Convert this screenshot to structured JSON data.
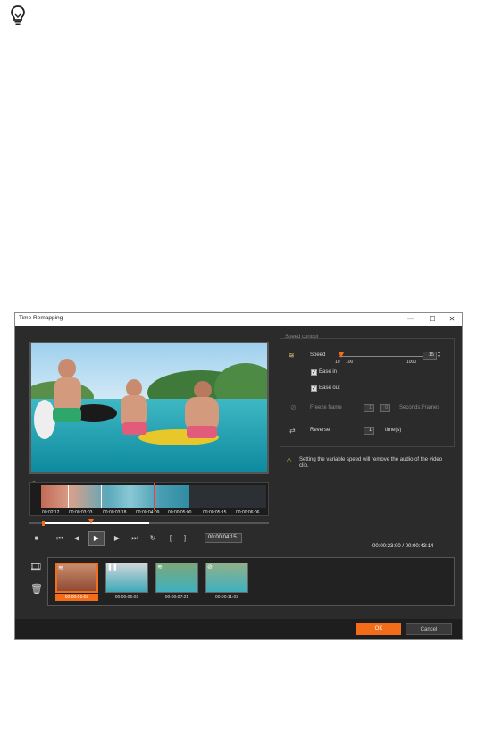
{
  "dialog": {
    "title": "Time Remapping",
    "window_buttons": {
      "minimize": "—",
      "maximize": "☐",
      "close": "✕"
    }
  },
  "strip_timecodes": [
    "00:02:12",
    "00:00:03:03",
    "00:00:03:18",
    "00:00:04:09",
    "00:00:05:00",
    "00:00:05:15",
    "00:00:06:06"
  ],
  "transport": {
    "timecode": "00:00:04:15",
    "in_mark": "[",
    "out_mark": "]"
  },
  "speed_control": {
    "section_title": "Speed control",
    "speed_label": "Speed",
    "speed_value": "15",
    "speed_min_label": "10",
    "speed_mid_label": "100",
    "speed_max_label": "1000",
    "speed_fraction": 0.02,
    "ease_in_label": "Ease in",
    "ease_in_checked": true,
    "ease_out_label": "Ease out",
    "ease_out_checked": true,
    "freeze_label": "Freeze frame",
    "freeze_seconds": "1",
    "freeze_frames": "0",
    "seconds_frames_label": "Seconds:Frames",
    "reverse_label": "Reverse",
    "reverse_value": "1",
    "times_label": "time(s)"
  },
  "warning_text": "Setting the variable speed will remove the audio of the video clip.",
  "duration": "00:00:23:00 / 00:00:43:14",
  "clips": [
    {
      "time": "00:00:01:03",
      "selected": true,
      "icon": "speed-icon"
    },
    {
      "time": "00:00:06:03",
      "selected": false,
      "icon": "freeze-icon"
    },
    {
      "time": "00:00:07:21",
      "selected": false,
      "icon": "speed-icon"
    },
    {
      "time": "00:00:11:03",
      "selected": false,
      "icon": "reverse-icon"
    }
  ],
  "footer": {
    "ok_label": "OK",
    "cancel_label": "Cancel"
  },
  "colors": {
    "accent": "#f26c1a",
    "dialog_bg": "#2b2b2b",
    "text": "#d8d8d8"
  }
}
